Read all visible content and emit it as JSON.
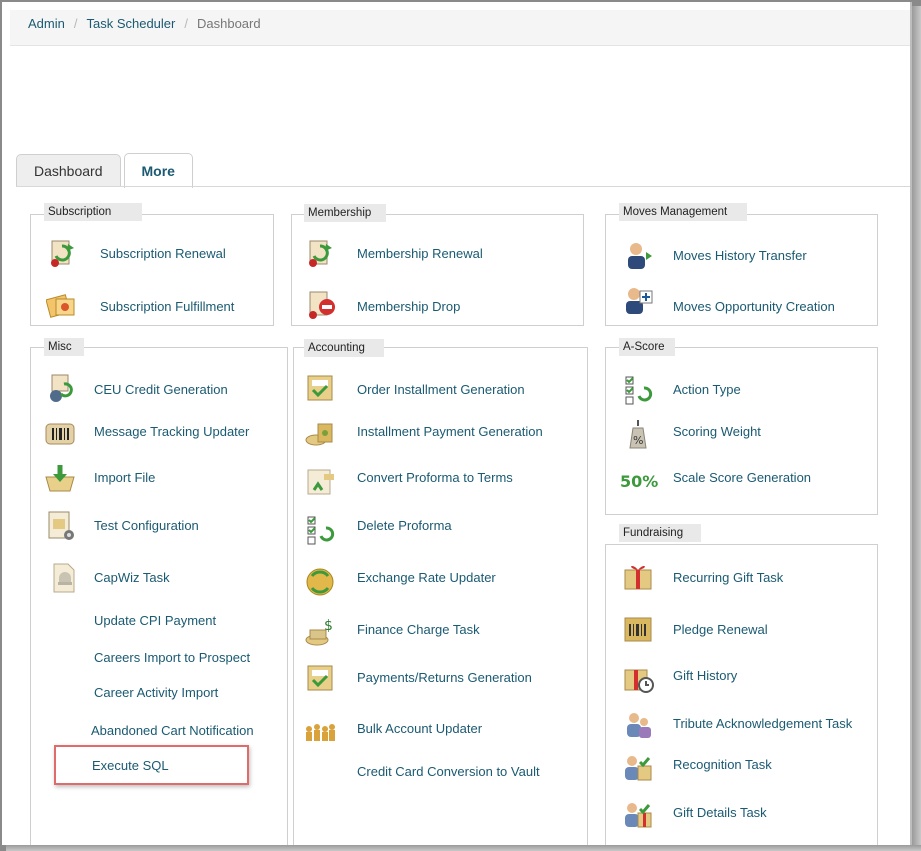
{
  "breadcrumb": [
    "Admin",
    "Task Scheduler",
    "Dashboard"
  ],
  "tabs": [
    {
      "label": "Dashboard",
      "active": false
    },
    {
      "label": "More",
      "active": true
    }
  ],
  "panels": {
    "subscription": {
      "title": "Subscription",
      "items": [
        "Subscription Renewal",
        "Subscription Fulfillment"
      ]
    },
    "membership": {
      "title": "Membership",
      "items": [
        "Membership Renewal",
        "Membership Drop"
      ]
    },
    "moves": {
      "title": "Moves Management",
      "items": [
        "Moves History Transfer",
        "Moves Opportunity Creation"
      ]
    },
    "misc": {
      "title": "Misc",
      "items": [
        "CEU Credit Generation",
        "Message Tracking Updater",
        "Import File",
        "Test Configuration",
        "CapWiz Task",
        "Update CPI Payment",
        "Careers Import to Prospect",
        "Career Activity Import",
        "Abandoned Cart Notification",
        "Execute SQL"
      ]
    },
    "accounting": {
      "title": "Accounting",
      "items": [
        "Order Installment Generation",
        "Installment Payment Generation",
        "Convert Proforma to Terms",
        "Delete Proforma",
        "Exchange Rate Updater",
        "Finance Charge Task",
        "Payments/Returns Generation",
        "Bulk Account Updater",
        "Credit Card Conversion to Vault"
      ]
    },
    "ascore": {
      "title": "A-Score",
      "items": [
        "Action Type",
        "Scoring Weight",
        "Scale Score Generation"
      ],
      "badge": "50%"
    },
    "fundraising": {
      "title": "Fundraising",
      "items": [
        "Recurring Gift Task",
        "Pledge Renewal",
        "Gift History",
        "Tribute Acknowledgement Task",
        "Recognition Task",
        "Gift Details Task"
      ]
    }
  },
  "colors": {
    "link": "#1a5a72",
    "highlight": "#e06b6b",
    "legend_bg": "#e9e9e9"
  }
}
